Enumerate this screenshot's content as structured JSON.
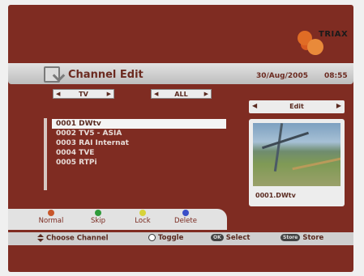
{
  "logo": {
    "text": "TRIAX"
  },
  "header": {
    "title": "Channel Edit",
    "date": "30/Aug/2005",
    "time": "08:55"
  },
  "filters": {
    "group": "TV",
    "category": "ALL"
  },
  "channels": [
    {
      "label": "0001 DWtv",
      "selected": true
    },
    {
      "label": "0002 TV5 - ASIA",
      "selected": false
    },
    {
      "label": "0003 RAI Internat",
      "selected": false
    },
    {
      "label": "0004 TVE",
      "selected": false
    },
    {
      "label": "0005 RTPi",
      "selected": false
    }
  ],
  "mode": {
    "label": "Edit"
  },
  "preview": {
    "caption": "0001.DWtv"
  },
  "color_keys": [
    {
      "label": "Normal",
      "color": "#c8562a"
    },
    {
      "label": "Skip",
      "color": "#2f9a3a"
    },
    {
      "label": "Lock",
      "color": "#d7d33a"
    },
    {
      "label": "Delete",
      "color": "#3a4fc8"
    }
  ],
  "help": {
    "choose": "Choose Channel",
    "toggle": "Toggle",
    "select": "Select",
    "select_key": "OK",
    "store": "Store",
    "store_key": "Store"
  },
  "colors": {
    "background": "#7f2c22",
    "bar": "#d8d8d8",
    "text_dark": "#5a2a20"
  }
}
